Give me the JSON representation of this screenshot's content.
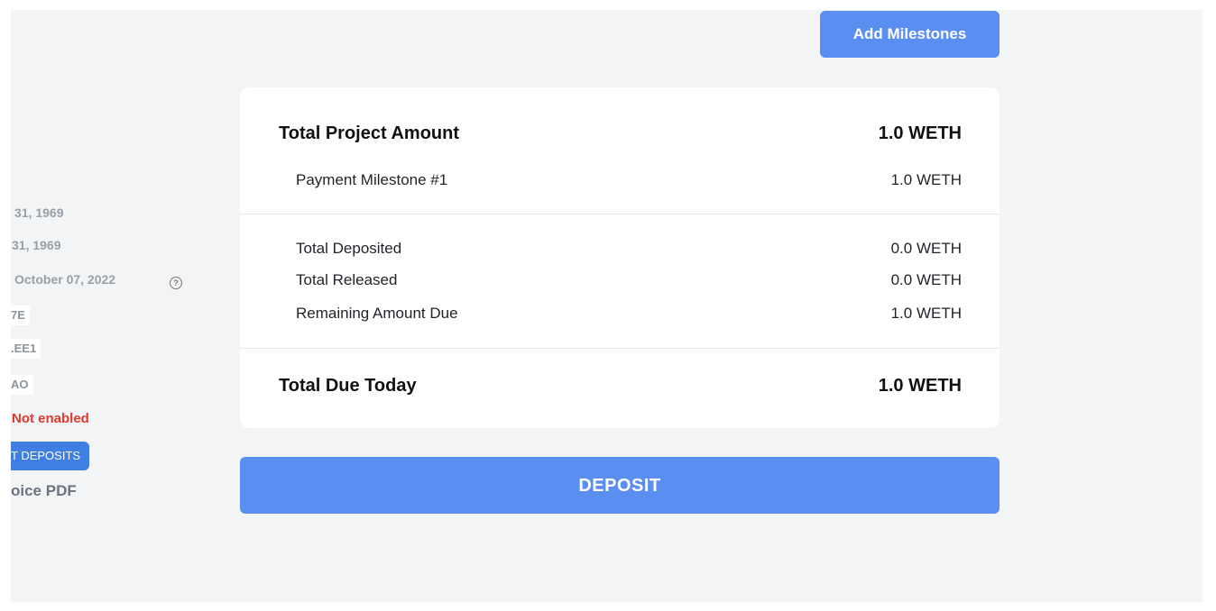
{
  "sidebar": {
    "date_line_1": "31, 1969",
    "date_line_2": "31, 1969",
    "date_line_3": "October 07, 2022",
    "help_icon": "question-circle-icon",
    "address_1": "7E",
    "address_2": ".EE1",
    "address_3": "AO",
    "status_text": "Not enabled",
    "deposits_button": "T DEPOSITS",
    "invoice_link": "oice PDF",
    "status_color": "#e03a2d",
    "button_color": "#3f7fe3"
  },
  "header": {
    "add_milestones_label": "Add Milestones"
  },
  "summary": {
    "total_project_label": "Total Project Amount",
    "total_project_value": "1.0 WETH",
    "milestone_label": "Payment Milestone #1",
    "milestone_value": "1.0 WETH",
    "total_deposited_label": "Total Deposited",
    "total_deposited_value": "0.0 WETH",
    "total_released_label": "Total Released",
    "total_released_value": "0.0 WETH",
    "remaining_label": "Remaining Amount Due",
    "remaining_value": "1.0 WETH",
    "total_due_label": "Total Due Today",
    "total_due_value": "1.0 WETH"
  },
  "actions": {
    "deposit_label": "DEPOSIT",
    "accent_color": "#5a8ef0"
  }
}
